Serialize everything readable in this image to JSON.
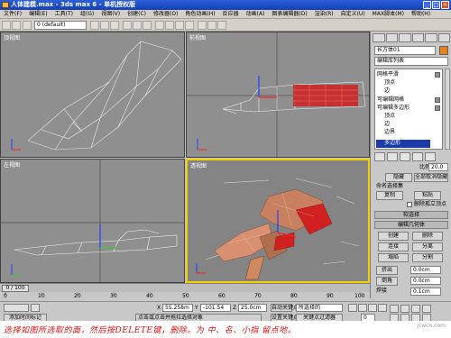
{
  "window": {
    "title": "人体建模.max - 3ds max 6 - 单机授权版"
  },
  "menu": [
    "文件(F)",
    "编辑(E)",
    "工具(T)",
    "组(G)",
    "视图(V)",
    "创建(C)",
    "修改器(O)",
    "角色动画(H)",
    "反应器",
    "动画(A)",
    "图表编辑器(D)",
    "渲染(R)",
    "自定义(U)",
    "MAX脚本(M)",
    "帮助(H)"
  ],
  "toolbar": {
    "layer_select": "0 (default)"
  },
  "viewports": {
    "top_left": "顶视图",
    "top_right": "前视图",
    "bottom_left": "左视图",
    "bottom_right": "透视图"
  },
  "command_panel": {
    "object_name": "长方体01",
    "modifier_list": "编辑库列表",
    "stack": [
      "可编辑多边形",
      "顶点",
      "边",
      "边界",
      "多边形"
    ],
    "stack_groups": [
      "网格平滑",
      "可编辑网格"
    ],
    "selection_rollout": "选择",
    "by_vertex": "按顶点",
    "ignore_backfacing": "忽略背面",
    "by_angle": "按角度",
    "angle_value": "45.0",
    "shrink": "收缩",
    "grow": "扩大",
    "ring": "环形",
    "loop": "循环",
    "soft_selection_rollout": "软选择",
    "edit_geometry_rollout": "编辑几何体",
    "create": "创建",
    "delete": "删除",
    "attach": "连接",
    "detach": "分离",
    "collapse": "塌陷",
    "split": "分割",
    "extrude": "挤出",
    "extrude_value": "0.0cm",
    "chamfer": "倒角",
    "chamfer_value": "0.0cm",
    "weld": "焊接",
    "weld_value": "0.1cm",
    "slice_plane": "切割平面",
    "cut": "切片",
    "ratio_label": "比例",
    "ratio_value": "20.0",
    "hide": "隐藏",
    "unhide_all": "全部取消隐藏",
    "named_sel": "命名选择集",
    "copy": "复制",
    "paste": "粘贴",
    "delete_isolated": "删除孤立顶点"
  },
  "timeline": {
    "thumb": "0 / 100",
    "ticks": [
      "0",
      "10",
      "20",
      "30",
      "40",
      "50",
      "60",
      "70",
      "80",
      "90",
      "100"
    ]
  },
  "status": {
    "coord_x": "55.258m",
    "coord_y": "-101.54",
    "coord_z": "25.0cm",
    "grid": "栅格 = 10.0cm",
    "auto_key": "自动关键点",
    "set_key": "设置关键点",
    "selected": "所选择的",
    "key_filters": "关键点过滤器",
    "prompt": "点击或点击并拖拉选择对象",
    "add_time_tag": "添加时间标记",
    "frame": "0"
  },
  "caption": {
    "text": "选择如图所选取的面，然后按DELETE键，删除。为 中、名、小指 留点地。",
    "watermark": "jcwcn.com"
  }
}
